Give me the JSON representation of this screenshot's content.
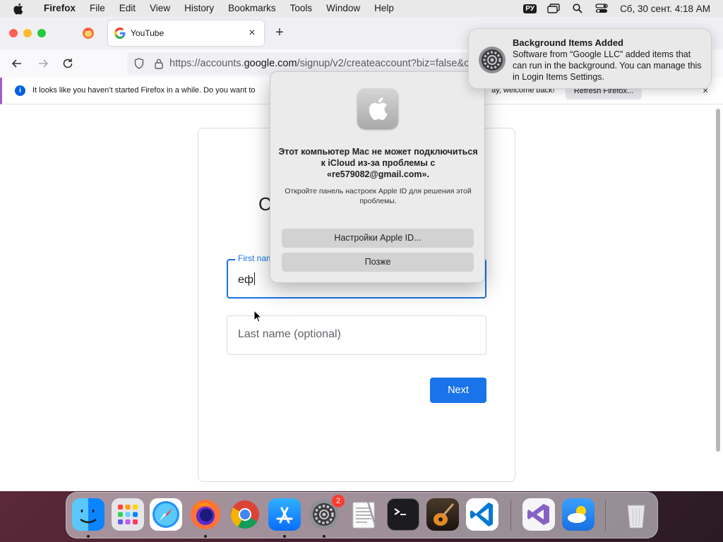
{
  "menubar": {
    "app_name": "Firefox",
    "items": [
      "File",
      "Edit",
      "View",
      "History",
      "Bookmarks",
      "Tools",
      "Window",
      "Help"
    ],
    "input_source": "РУ",
    "clock": "Сб, 30 сент.  4:18 AM"
  },
  "browser": {
    "tab_title": "YouTube",
    "url_prefix": "https://accounts.",
    "url_host": "google.com",
    "url_rest": "/signup/v2/createaccount?biz=false&c",
    "infobar_message": "It looks like you haven’t started Firefox in a while. Do you want to",
    "infobar_tail": "ay, welcome back!",
    "infobar_button": "Refresh Firefox..."
  },
  "page": {
    "heading_fragment": "C",
    "first_name_label": "First nam",
    "first_name_value": "еф",
    "last_name_placeholder": "Last name (optional)",
    "next_button": "Next"
  },
  "alert": {
    "title": "Этот компьютер Mac не может подключиться к iCloud из-за проблемы с «re579082@gmail.com».",
    "body": "Откройте панель настроек Apple ID для решения этой проблемы.",
    "primary_button": "Настройки Apple ID...",
    "secondary_button": "Позже"
  },
  "notification": {
    "title": "Background Items Added",
    "body": "Software from “Google LLC” added items that can run in the background. You can manage this in Login Items Settings."
  },
  "dock": {
    "settings_badge": "2"
  },
  "colors": {
    "google_blue": "#1a73e8",
    "firefox_blue": "#0060df",
    "badge_red": "#ff3b30"
  }
}
